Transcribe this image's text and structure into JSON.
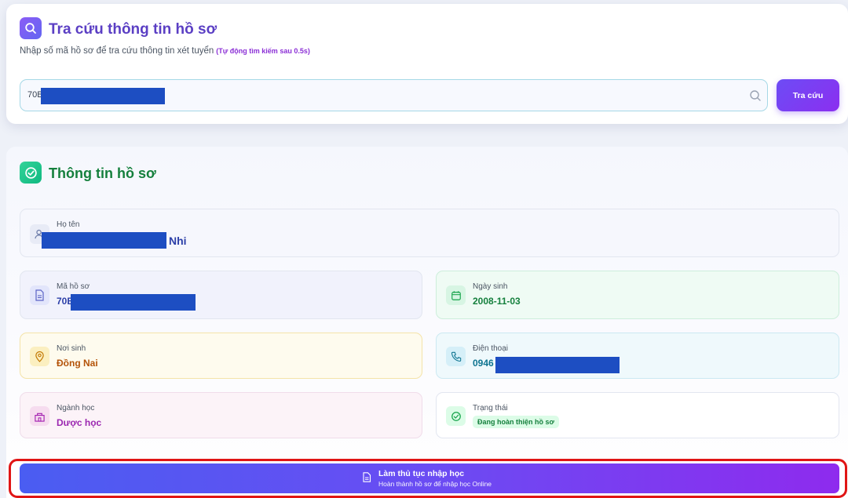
{
  "search": {
    "title": "Tra cứu thông tin hồ sơ",
    "subtitle": "Nhập số mã hồ sơ để tra cứu thông tin xét tuyển",
    "auto_note": "(Tự động tìm kiếm sau 0.5s)",
    "input_value": "70B",
    "button_label": "Tra cứu",
    "icon": "search-icon"
  },
  "result": {
    "title": "Thông tin hồ sơ",
    "icon": "check-circle-icon",
    "fields": {
      "name": {
        "label": "Họ tên",
        "value": "Nhi",
        "icon": "user-icon"
      },
      "code": {
        "label": "Mã hồ sơ",
        "value": "70B",
        "icon": "document-icon"
      },
      "dob": {
        "label": "Ngày sinh",
        "value": "2008-11-03",
        "icon": "calendar-icon"
      },
      "place": {
        "label": "Nơi sinh",
        "value": "Đồng Nai",
        "icon": "map-pin-icon"
      },
      "phone": {
        "label": "Điện thoại",
        "value": "0946",
        "icon": "phone-icon"
      },
      "major": {
        "label": "Ngành học",
        "value": "Dược học",
        "icon": "school-icon"
      },
      "status": {
        "label": "Trạng thái",
        "value": "Đang hoàn thiện hồ sơ",
        "icon": "check-circle-icon"
      }
    }
  },
  "enroll": {
    "title": "Làm thủ tục nhập học",
    "subtitle": "Hoàn thành hồ sơ để nhập học Online",
    "icon": "document-icon"
  },
  "colors": {
    "search_accent": "#5b3fc4",
    "result_accent": "#15803d",
    "redaction": "#1d4ec2",
    "highlight_outline": "#e01515"
  }
}
